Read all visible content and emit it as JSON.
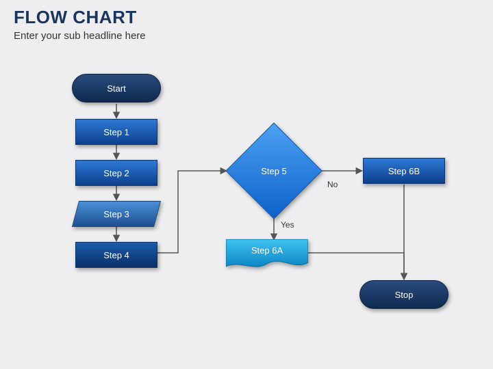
{
  "header": {
    "title": "FLOW CHART",
    "subtitle": "Enter your sub headline here"
  },
  "nodes": {
    "start": "Start",
    "step1": "Step 1",
    "step2": "Step 2",
    "step3": "Step 3",
    "step4": "Step 4",
    "decision": "Step 5",
    "step6a": "Step 6A",
    "step6b": "Step 6B",
    "stop": "Stop"
  },
  "edges": {
    "yes": "Yes",
    "no": "No"
  },
  "palette": {
    "dark_navy": "#0f2a50",
    "blue_gradient_top": "#2d78d6",
    "blue_gradient_bottom": "#0d3f8a",
    "cyan": "#1fa8e0",
    "background": "#eeeef0"
  }
}
